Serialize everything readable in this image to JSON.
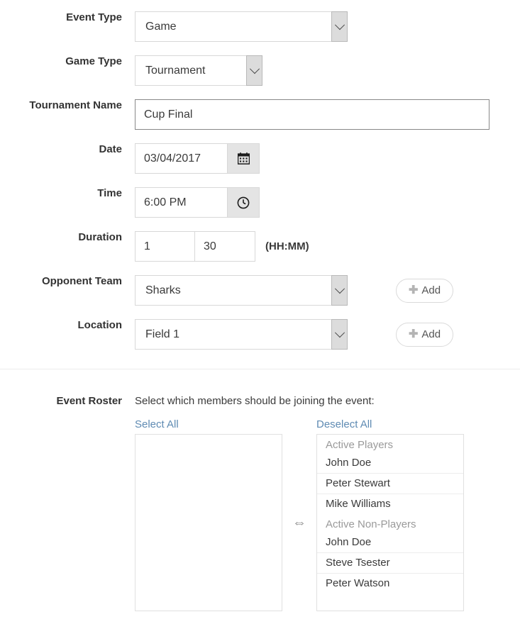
{
  "form": {
    "rows": [
      {
        "label": "Event Type",
        "value": "Game"
      },
      {
        "label": "Game Type",
        "value": "Tournament"
      },
      {
        "label": "Tournament Name",
        "value": "Cup Final"
      },
      {
        "label": "Date",
        "value": "03/04/2017"
      },
      {
        "label": "Time",
        "value": "6:00 PM"
      },
      {
        "label": "Duration",
        "hours": "1",
        "minutes": "30",
        "hint": "(HH:MM)"
      },
      {
        "label": "Opponent Team",
        "value": "Sharks",
        "add_label": "Add"
      },
      {
        "label": "Location",
        "value": "Field 1",
        "add_label": "Add"
      }
    ]
  },
  "icons": {
    "calendar": "calendar-icon",
    "clock": "clock-icon",
    "chevron_down": "chevron-down-icon",
    "plus": "plus-icon",
    "transfer": "transfer-arrows-icon"
  },
  "roster": {
    "label": "Event Roster",
    "instruction": "Select which members should be joining the event:",
    "select_all_label": "Select All",
    "deselect_all_label": "Deselect All",
    "transfer_glyph": "⇔",
    "selected_list": [],
    "available_list": [
      {
        "type": "group",
        "label": "Active Players"
      },
      {
        "type": "item",
        "label": "John Doe"
      },
      {
        "type": "item",
        "label": "Peter Stewart"
      },
      {
        "type": "item",
        "label": "Mike Williams"
      },
      {
        "type": "group",
        "label": "Active Non-Players"
      },
      {
        "type": "item",
        "label": "John Doe"
      },
      {
        "type": "item",
        "label": "Steve Tsester"
      },
      {
        "type": "item",
        "label": "Peter Watson"
      }
    ]
  },
  "colors": {
    "link": "#5f8bb3",
    "label_text": "#333333",
    "border": "#d8d8d8",
    "select_arrow_bg": "#dcdcdc",
    "group_header": "#9a9a9a"
  }
}
